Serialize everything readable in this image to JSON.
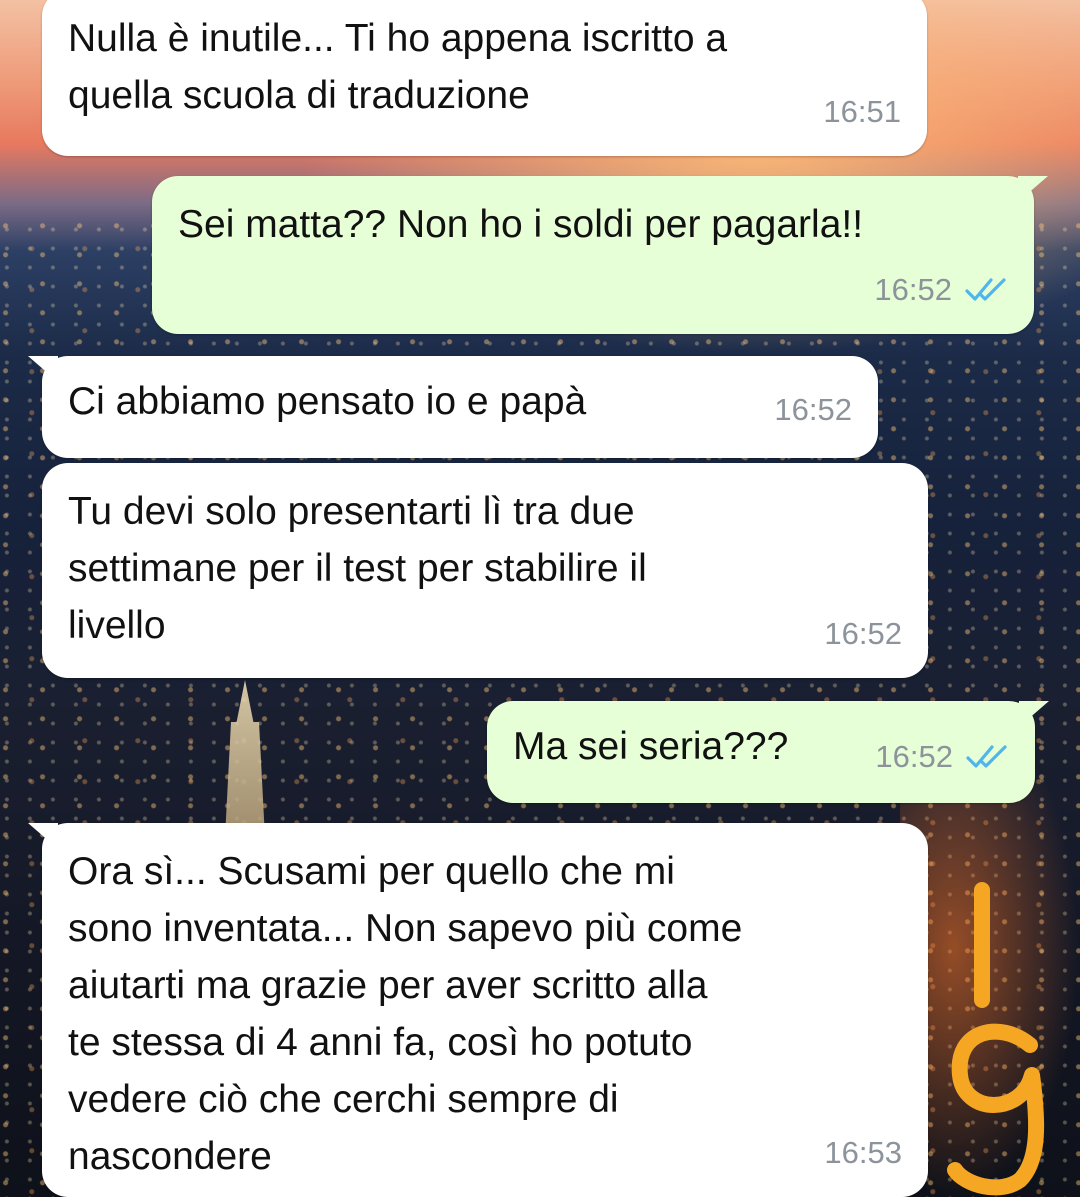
{
  "chat": {
    "messages": [
      {
        "direction": "incoming",
        "text": "Nulla è inutile... Ti ho appena iscritto a\nquella scuola di traduzione",
        "time": "16:51",
        "read": false
      },
      {
        "direction": "outgoing",
        "text": "Sei matta?? Non ho i soldi per pagarla!!",
        "time": "16:52",
        "read": true
      },
      {
        "direction": "incoming",
        "text": "Ci abbiamo pensato io e papà",
        "time": "16:52",
        "read": false
      },
      {
        "direction": "incoming",
        "text": "Tu devi solo presentarti lì tra due\nsettimane per il test per stabilire il\nlivello",
        "time": "16:52",
        "read": false
      },
      {
        "direction": "outgoing",
        "text": "Ma sei seria???",
        "time": "16:52",
        "read": true
      },
      {
        "direction": "incoming",
        "text": "Ora sì... Scusami per quello che mi\nsono inventata... Non sapevo più come\naiutarti ma grazie per aver scritto alla\nte stessa di 4 anni fa, così ho potuto\nvedere ciò che cerchi sempre di\nnascondere",
        "time": "16:53",
        "read": false
      }
    ]
  },
  "colors": {
    "incoming_bubble": "#ffffff",
    "outgoing_bubble": "#e6ffd6",
    "timestamp": "#8c939b",
    "read_ticks": "#4fb6ec",
    "doodle": "#f5a623"
  },
  "icons": {
    "read_receipt": "double-check-icon",
    "annotation": "handwritten-doodle"
  }
}
